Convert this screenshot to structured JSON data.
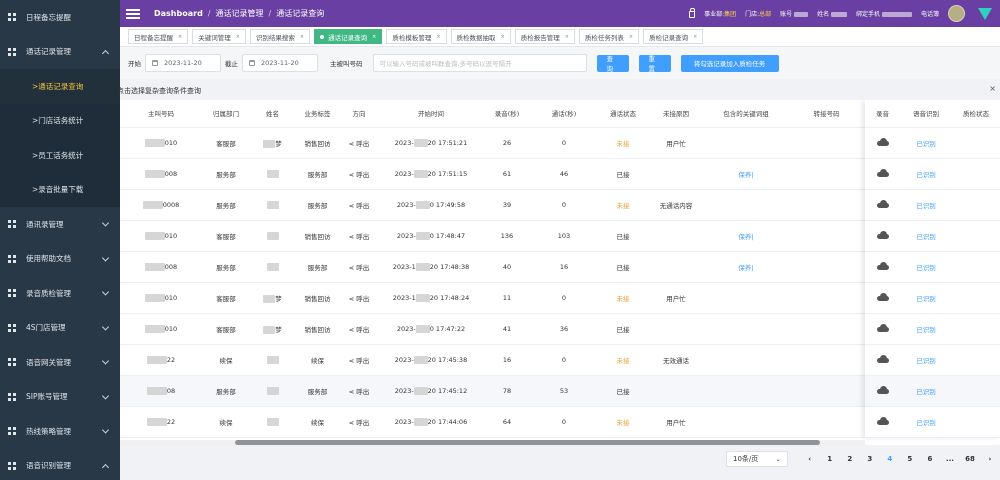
{
  "sidebar": {
    "items": [
      {
        "label": "日程备忘提醒",
        "type": "item",
        "expanded": false,
        "chevron": false
      },
      {
        "label": "通话记录管理",
        "type": "item",
        "expanded": true,
        "chevron": true
      },
      {
        "label": ">通话记录查询",
        "type": "sub",
        "active": true
      },
      {
        "label": ">门店话务统计",
        "type": "sub",
        "active": false
      },
      {
        "label": ">员工话务统计",
        "type": "sub",
        "active": false
      },
      {
        "label": ">录音批量下载",
        "type": "sub",
        "active": false
      },
      {
        "label": "通讯录管理",
        "type": "item",
        "chevron": true
      },
      {
        "label": "使用帮助文档",
        "type": "item",
        "chevron": true
      },
      {
        "label": "录音质检管理",
        "type": "item",
        "chevron": true
      },
      {
        "label": "4S门店管理",
        "type": "item",
        "chevron": true
      },
      {
        "label": "语音网关管理",
        "type": "item",
        "chevron": true
      },
      {
        "label": "SIP账号管理",
        "type": "item",
        "chevron": true
      },
      {
        "label": "热线策略管理",
        "type": "item",
        "chevron": true
      },
      {
        "label": "语音识别管理",
        "type": "item",
        "chevron": true,
        "expanded": true
      }
    ]
  },
  "topbar": {
    "breadcrumb": [
      "Dashboard",
      "通话记录管理",
      "通话记录查询"
    ],
    "info": {
      "dept_label": "事业部:",
      "dept_value": "集团",
      "store_label": "门店:",
      "store_value": "总部",
      "account_label": "账号",
      "name_label": "姓名",
      "phone_label": "绑定手机",
      "status_label": "电话簿"
    },
    "accent": "#6a3fa3"
  },
  "tabs": [
    {
      "label": "日程备忘提醒",
      "active": false
    },
    {
      "label": "关键词管理",
      "active": false
    },
    {
      "label": "识别结果搜索",
      "active": false
    },
    {
      "label": "通话记录查询",
      "active": true
    },
    {
      "label": "质检模板管理",
      "active": false
    },
    {
      "label": "质检数据抽取",
      "active": false
    },
    {
      "label": "质检报告管理",
      "active": false
    },
    {
      "label": "质检任务列表",
      "active": false
    },
    {
      "label": "质检记录查询",
      "active": false
    }
  ],
  "filters": {
    "start_label": "开始",
    "start_value": "2023-11-20",
    "end_label": "截止",
    "end_value": "2023-11-20",
    "caller_label": "主被叫号码",
    "search_placeholder": "可以输入号码或被叫群查询,多号码以逗号隔开",
    "query_btn": "查询",
    "reset_btn": "重置",
    "add_task_btn": "将勾选记录加入质检任务"
  },
  "hint_text": "点击选择复杂查询条件查询",
  "close_icon": "×",
  "table": {
    "columns": [
      "主叫号码",
      "归属部门",
      "姓名",
      "业务标签",
      "方向",
      "开始时间",
      "录音(秒)",
      "通话(秒)",
      "通话状态",
      "未接原因",
      "包含的关键词组",
      "转接号码"
    ],
    "fixed_columns": [
      "录音",
      "语音识别",
      "质检状态"
    ],
    "direction_text": "呼出",
    "rows": [
      {
        "num": "010",
        "dept": "客服部",
        "name": "梦",
        "tag": "销售回访",
        "time_a": "2023-",
        "time_b": "20 17:51:21",
        "rec": "26",
        "talk": "0",
        "status": "未接",
        "reason": "用户忙",
        "kw": "",
        "alt": false,
        "recog": "已识别"
      },
      {
        "num": "008",
        "dept": "服务部",
        "name": "",
        "tag": "服务部",
        "time_a": "2023-",
        "time_b": "20 17:51:15",
        "rec": "61",
        "talk": "46",
        "status": "已接",
        "reason": "",
        "kw": "保养|",
        "alt": false,
        "recog": "已识别"
      },
      {
        "num": "0008",
        "dept": "服务部",
        "name": "",
        "tag": "服务部",
        "time_a": "2023-",
        "time_b": "0 17:49:58",
        "rec": "39",
        "talk": "0",
        "status": "未接",
        "reason": "无通话内容",
        "kw": "",
        "alt": false,
        "recog": "已识别"
      },
      {
        "num": "010",
        "dept": "客服部",
        "name": "",
        "tag": "销售回访",
        "time_a": "2023-",
        "time_b": "0 17:48:47",
        "rec": "136",
        "talk": "103",
        "status": "已接",
        "reason": "",
        "kw": "保养|",
        "alt": false,
        "recog": "已识别"
      },
      {
        "num": "008",
        "dept": "服务部",
        "name": "",
        "tag": "服务部",
        "time_a": "2023-1",
        "time_b": "20 17:48:38",
        "rec": "40",
        "talk": "16",
        "status": "已接",
        "reason": "",
        "kw": "保养|",
        "alt": false,
        "recog": "已识别"
      },
      {
        "num": "010",
        "dept": "客服部",
        "name": "梦",
        "tag": "销售回访",
        "time_a": "2023-1",
        "time_b": "20 17:48:24",
        "rec": "11",
        "talk": "0",
        "status": "未接",
        "reason": "用户忙",
        "kw": "",
        "alt": false,
        "recog": "已识别"
      },
      {
        "num": "010",
        "dept": "客服部",
        "name": "梦",
        "tag": "销售回访",
        "time_a": "2023-",
        "time_b": "0 17:47:22",
        "rec": "41",
        "talk": "36",
        "status": "已接",
        "reason": "",
        "kw": "",
        "alt": false,
        "recog": "已识别"
      },
      {
        "num": "22",
        "dept": "续保",
        "name": "",
        "tag": "续保",
        "time_a": "2023-",
        "time_b": "20 17:45:38",
        "rec": "16",
        "talk": "0",
        "status": "未接",
        "reason": "无效通话",
        "kw": "",
        "alt": false,
        "recog": "已识别"
      },
      {
        "num": "08",
        "dept": "服务部",
        "name": "",
        "tag": "服务部",
        "time_a": "2023-",
        "time_b": "20 17:45:12",
        "rec": "78",
        "talk": "53",
        "status": "已接",
        "reason": "",
        "kw": "",
        "alt": true,
        "recog": "已识别"
      },
      {
        "num": "22",
        "dept": "续保",
        "name": "",
        "tag": "续保",
        "time_a": "2023-",
        "time_b": "20 17:44:06",
        "rec": "64",
        "talk": "0",
        "status": "未接",
        "reason": "用户忙",
        "kw": "",
        "alt": false,
        "recog": "已识别"
      }
    ]
  },
  "pagination": {
    "page_size": "10条/页",
    "prev": "‹",
    "next": "›",
    "pages": [
      "1",
      "2",
      "3",
      "4",
      "5",
      "6",
      "...",
      "68"
    ],
    "current": "4"
  }
}
